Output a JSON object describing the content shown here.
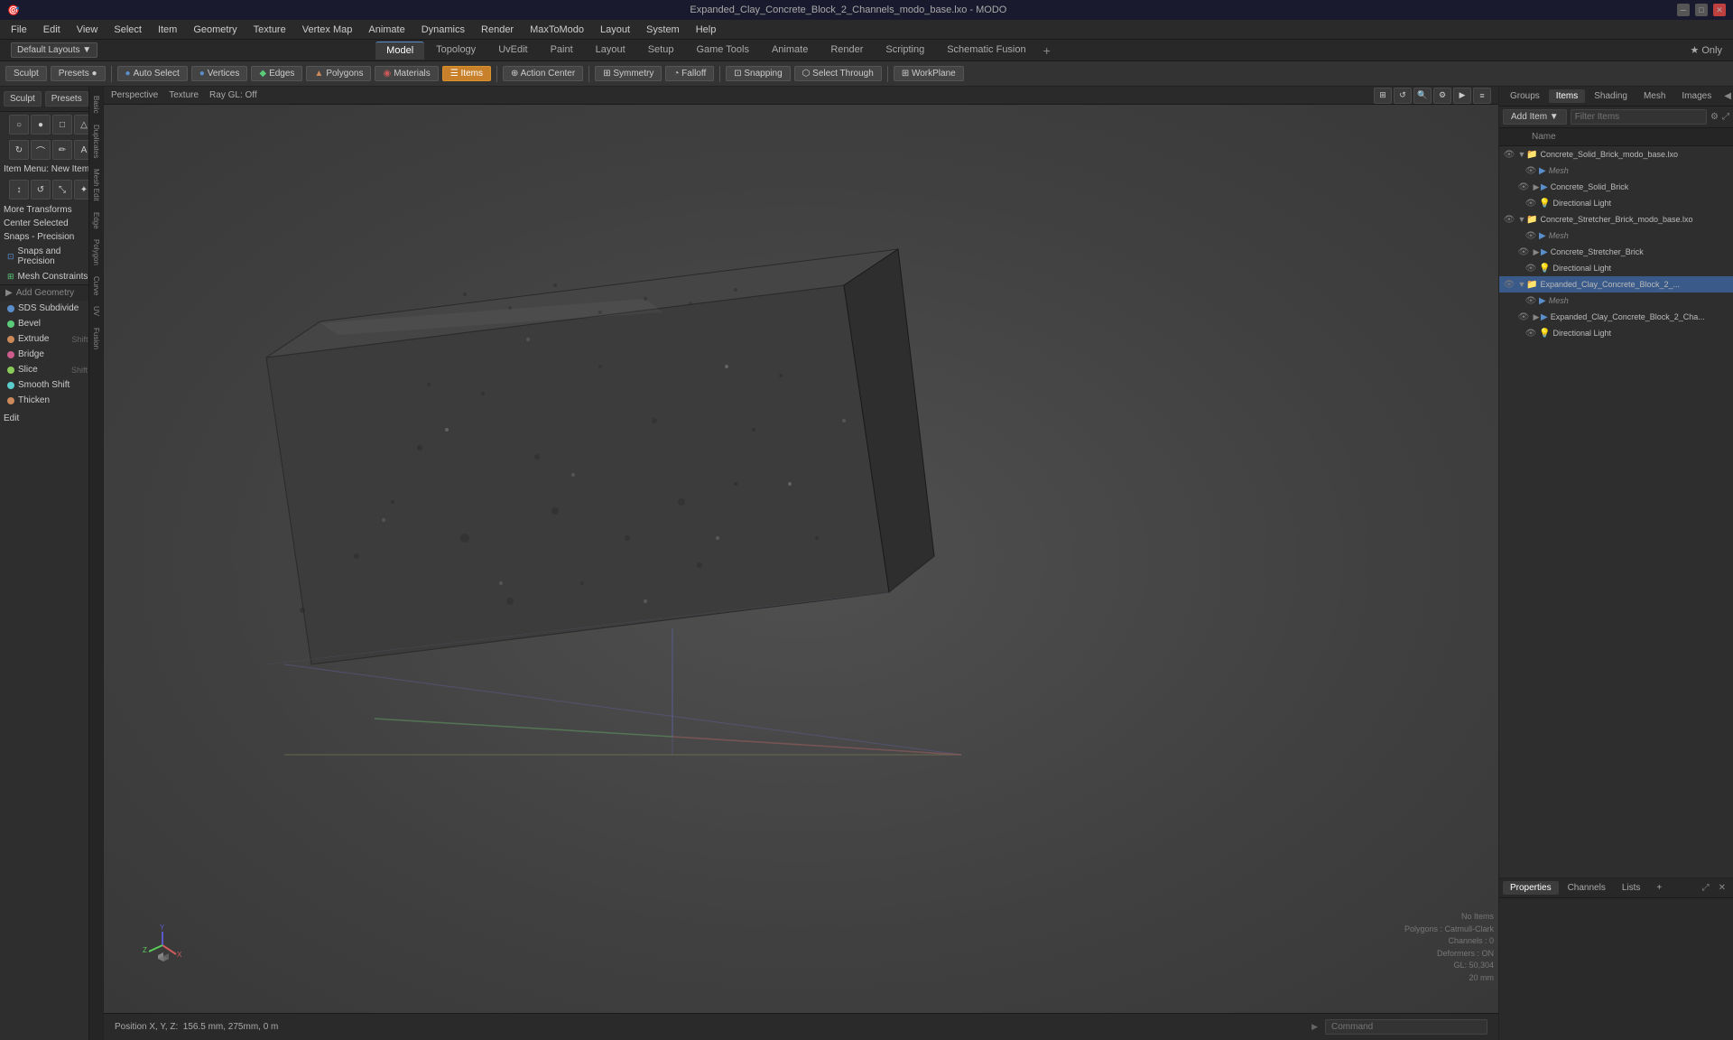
{
  "window": {
    "title": "Expanded_Clay_Concrete_Block_2_Channels_modo_base.lxo - MODO"
  },
  "titlebar": {
    "title": "Expanded_Clay_Concrete_Block_2_Channels_modo_base.lxo - MODO",
    "minimize": "─",
    "maximize": "□",
    "close": "✕"
  },
  "menubar": {
    "items": [
      "File",
      "Edit",
      "View",
      "Select",
      "Item",
      "Geometry",
      "Texture",
      "Vertex Map",
      "Animate",
      "Dynamics",
      "Render",
      "MaxToModo",
      "Layout",
      "System",
      "Help"
    ]
  },
  "tabs": {
    "items": [
      "Model",
      "Topology",
      "UvEdit",
      "Paint",
      "Layout",
      "Setup",
      "Game Tools",
      "Animate",
      "Render",
      "Scripting",
      "Schematic Fusion"
    ],
    "active": "Model",
    "star_label": "★ Only"
  },
  "toolbar": {
    "sculpt_label": "Sculpt",
    "presets_label": "Presets",
    "buttons": [
      {
        "label": "Auto Select",
        "icon": "●",
        "active": false
      },
      {
        "label": "Vertices",
        "icon": "●",
        "active": false
      },
      {
        "label": "Edges",
        "icon": "◆",
        "active": false
      },
      {
        "label": "Polygons",
        "icon": "▲",
        "active": false
      },
      {
        "label": "Materials",
        "icon": "◉",
        "active": false
      },
      {
        "label": "Items",
        "icon": "☰",
        "active": true
      },
      {
        "label": "Action Center",
        "icon": "⊕",
        "active": false
      },
      {
        "label": "Symmetry",
        "icon": "⊞",
        "active": false
      },
      {
        "label": "Falloff",
        "icon": "◔",
        "active": false
      },
      {
        "label": "Snapping",
        "icon": "⊡",
        "active": false
      },
      {
        "label": "Select Through",
        "icon": "⬡",
        "active": false
      },
      {
        "label": "WorkPlane",
        "icon": "⊞",
        "active": false
      }
    ]
  },
  "left_panel": {
    "item_menu_label": "Item Menu: New Item",
    "transforms_label": "More Transforms",
    "center_selected_label": "Center Selected",
    "snaps_precision_label": "Snaps - Precision",
    "snaps_items": [
      {
        "label": "Snaps and Precision",
        "icon": "snap"
      },
      {
        "label": "Mesh Constraints",
        "icon": "mesh"
      }
    ],
    "add_geometry_label": "Add Geometry",
    "geometry_items": [
      {
        "label": "SDS Subdivide",
        "shortcut": "",
        "icon": "sds"
      },
      {
        "label": "Bevel",
        "shortcut": "",
        "icon": "bevel"
      },
      {
        "label": "Extrude",
        "shortcut": "Shift V",
        "icon": "extrude"
      },
      {
        "label": "Bridge",
        "shortcut": "",
        "icon": "bridge"
      },
      {
        "label": "Slice",
        "shortcut": "Shift C",
        "icon": "slice"
      },
      {
        "label": "Smooth Shift",
        "shortcut": "",
        "icon": "smooth"
      },
      {
        "label": "Thicken",
        "shortcut": "",
        "icon": "thicken"
      }
    ],
    "edit_label": "Edit"
  },
  "viewport": {
    "perspective_label": "Perspective",
    "texture_label": "Texture",
    "ray_gl_label": "Ray GL: Off"
  },
  "scene_stats": {
    "no_items": "No Items",
    "polygons_label": "Polygons : Catmull-Clark",
    "channels_label": "Channels : 0",
    "deformers_label": "Deformers : ON",
    "gl_label": "GL: 50,304",
    "mm_label": "20 mm"
  },
  "status_bar": {
    "position_label": "Position X, Y, Z:",
    "position_value": "156.5 mm, 275mm, 0 m",
    "command_placeholder": "Command"
  },
  "right_panel": {
    "tabs": [
      "Groups",
      "Items",
      "Shading",
      "Mesh",
      "Images"
    ],
    "active_tab": "Items",
    "add_item_label": "Add Item",
    "filter_placeholder": "Filter Items",
    "name_col": "Name",
    "items": [
      {
        "id": "item1",
        "label": "Concrete_Solid_Brick_modo_base.lxo",
        "type": "file",
        "level": 0,
        "expanded": true,
        "children": [
          {
            "id": "item1a",
            "label": "Mesh",
            "type": "mesh",
            "level": 1,
            "italic": true
          },
          {
            "id": "item1b",
            "label": "Concrete_Solid_Brick",
            "type": "mesh",
            "level": 1,
            "expanded": false,
            "children": []
          },
          {
            "id": "item1c",
            "label": "Directional Light",
            "type": "light",
            "level": 1
          }
        ]
      },
      {
        "id": "item2",
        "label": "Concrete_Stretcher_Brick_modo_base.lxo",
        "type": "file",
        "level": 0,
        "expanded": true,
        "children": [
          {
            "id": "item2a",
            "label": "Mesh",
            "type": "mesh",
            "level": 1,
            "italic": true
          },
          {
            "id": "item2b",
            "label": "Concrete_Stretcher_Brick",
            "type": "mesh",
            "level": 1
          },
          {
            "id": "item2c",
            "label": "Directional Light",
            "type": "light",
            "level": 1
          }
        ]
      },
      {
        "id": "item3",
        "label": "Expanded_Clay_Concrete_Block_2_...",
        "type": "file",
        "level": 0,
        "expanded": true,
        "selected": true,
        "children": [
          {
            "id": "item3a",
            "label": "Mesh",
            "type": "mesh",
            "level": 1,
            "italic": true
          },
          {
            "id": "item3b",
            "label": "Expanded_Clay_Concrete_Block_2_Cha...",
            "type": "mesh",
            "level": 1
          },
          {
            "id": "item3c",
            "label": "Directional Light",
            "type": "light",
            "level": 1
          }
        ]
      }
    ],
    "bottom_tabs": [
      "Properties",
      "Channels",
      "Lists",
      "+"
    ]
  },
  "colors": {
    "accent_blue": "#5a8fcc",
    "accent_orange": "#c8812a",
    "bg_dark": "#2a2a2a",
    "bg_mid": "#333333",
    "bg_light": "#3c3c3c",
    "text_primary": "#cccccc",
    "text_dim": "#888888",
    "selected_bg": "#3a5a8a"
  }
}
